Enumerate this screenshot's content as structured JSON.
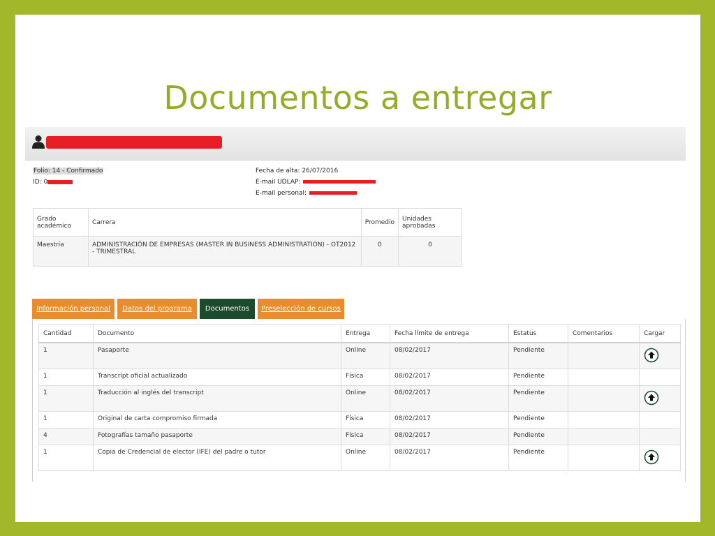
{
  "slide": {
    "title": "Documentos a entregar"
  },
  "student": {
    "folio_label": "Folio:",
    "folio_value": "14 - Confirmado",
    "id_label": "ID:",
    "id_prefix": "0",
    "fecha_label": "Fecha de alta:",
    "fecha_value": "26/07/2016",
    "email_udlap_label": "E-mail UDLAP:",
    "email_personal_label": "E-mail personal:"
  },
  "program_table": {
    "headers": [
      "Grado académico",
      "Carrera",
      "Promedio",
      "Unidades aprobadas"
    ],
    "row": [
      "Maestría",
      "ADMINISTRACIÓN DE EMPRESAS (MASTER IN BUSINESS ADMINISTRATION) - OT2012 - TRIMESTRAL",
      "0",
      "0"
    ]
  },
  "tabs": [
    {
      "label": "Información personal",
      "active": false
    },
    {
      "label": "Datos del programa",
      "active": false
    },
    {
      "label": "Documentos",
      "active": true
    },
    {
      "label": "Preselección de cursos",
      "active": false
    }
  ],
  "documents": {
    "headers": [
      "Cantidad",
      "Documento",
      "Entrega",
      "Fecha límite de entrega",
      "Estatus",
      "Comentarios",
      "Cargar"
    ],
    "rows": [
      {
        "cantidad": "1",
        "documento": "Pasaporte",
        "entrega": "Online",
        "fecha": "08/02/2017",
        "estatus": "Pendiente",
        "comentarios": "",
        "upload": true
      },
      {
        "cantidad": "1",
        "documento": "Transcript oficial actualizado",
        "entrega": "Física",
        "fecha": "08/02/2017",
        "estatus": "Pendiente",
        "comentarios": "",
        "upload": false
      },
      {
        "cantidad": "1",
        "documento": "Traducción al inglés del transcript",
        "entrega": "Online",
        "fecha": "08/02/2017",
        "estatus": "Pendiente",
        "comentarios": "",
        "upload": true
      },
      {
        "cantidad": "1",
        "documento": "Original de carta compromiso firmada",
        "entrega": "Física",
        "fecha": "08/02/2017",
        "estatus": "Pendiente",
        "comentarios": "",
        "upload": false
      },
      {
        "cantidad": "4",
        "documento": "Fotografías tamaño pasaporte",
        "entrega": "Física",
        "fecha": "08/02/2017",
        "estatus": "Pendiente",
        "comentarios": "",
        "upload": false
      },
      {
        "cantidad": "1",
        "documento": "Copia de Credencial de elector (IFE) del padre o tutor",
        "entrega": "Online",
        "fecha": "08/02/2017",
        "estatus": "Pendiente",
        "comentarios": "",
        "upload": true
      }
    ]
  },
  "colors": {
    "frame": "#a2b82a",
    "title": "#95ac2a",
    "tab_inactive": "#ea8c2c",
    "tab_active": "#1c4a2c",
    "redaction": "#e81e25"
  },
  "icons": {
    "user": "user-silhouette-icon",
    "upload": "upload-arrow-icon"
  }
}
